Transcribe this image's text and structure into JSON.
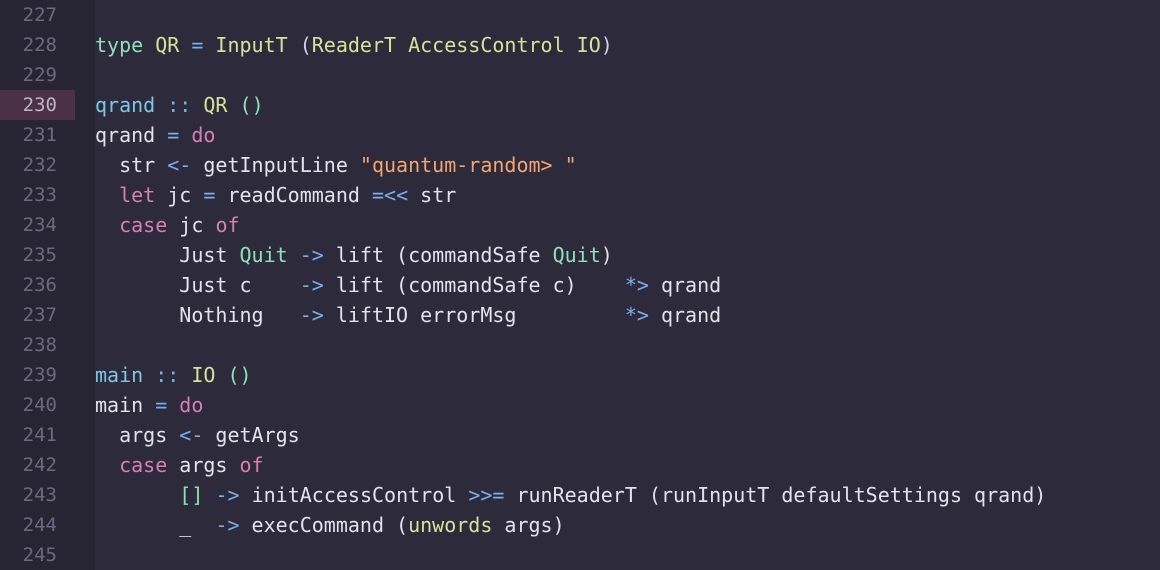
{
  "editor": {
    "current_line": 230,
    "lines": [
      {
        "n": "227",
        "tokens": []
      },
      {
        "n": "228",
        "tokens": [
          {
            "t": "type",
            "c": "tok-con"
          },
          {
            "t": " QR ",
            "c": "tok-type"
          },
          {
            "t": "=",
            "c": "tok-op"
          },
          {
            "t": " InputT ",
            "c": "tok-type"
          },
          {
            "t": "(",
            "c": "tok-paren"
          },
          {
            "t": "ReaderT AccessControl IO",
            "c": "tok-type"
          },
          {
            "t": ")",
            "c": "tok-paren"
          }
        ]
      },
      {
        "n": "229",
        "tokens": []
      },
      {
        "n": "230",
        "tokens": [
          {
            "t": "qrand",
            "c": "tok-fn"
          },
          {
            "t": " :: ",
            "c": "tok-op"
          },
          {
            "t": "QR",
            "c": "tok-type"
          },
          {
            "t": " ()",
            "c": "tok-con"
          }
        ]
      },
      {
        "n": "231",
        "tokens": [
          {
            "t": "qrand ",
            "c": "tok-plain"
          },
          {
            "t": "=",
            "c": "tok-op"
          },
          {
            "t": " do",
            "c": "tok-kw"
          }
        ]
      },
      {
        "n": "232",
        "tokens": [
          {
            "t": "  str ",
            "c": "tok-plain"
          },
          {
            "t": "<-",
            "c": "tok-op"
          },
          {
            "t": " getInputLine ",
            "c": "tok-plain"
          },
          {
            "t": "\"quantum-random> \"",
            "c": "tok-str"
          }
        ]
      },
      {
        "n": "233",
        "tokens": [
          {
            "t": "  ",
            "c": "tok-plain"
          },
          {
            "t": "let",
            "c": "tok-kw"
          },
          {
            "t": " jc ",
            "c": "tok-plain"
          },
          {
            "t": "=",
            "c": "tok-op"
          },
          {
            "t": " readCommand ",
            "c": "tok-plain"
          },
          {
            "t": "=<<",
            "c": "tok-op"
          },
          {
            "t": " str",
            "c": "tok-plain"
          }
        ]
      },
      {
        "n": "234",
        "tokens": [
          {
            "t": "  ",
            "c": "tok-plain"
          },
          {
            "t": "case",
            "c": "tok-kw"
          },
          {
            "t": " jc ",
            "c": "tok-plain"
          },
          {
            "t": "of",
            "c": "tok-kw"
          }
        ]
      },
      {
        "n": "235",
        "tokens": [
          {
            "t": "       Just ",
            "c": "tok-plain"
          },
          {
            "t": "Quit",
            "c": "tok-con"
          },
          {
            "t": " ",
            "c": "tok-plain"
          },
          {
            "t": "->",
            "c": "tok-op"
          },
          {
            "t": " lift (commandSafe ",
            "c": "tok-plain"
          },
          {
            "t": "Quit",
            "c": "tok-con"
          },
          {
            "t": ")",
            "c": "tok-plain"
          }
        ]
      },
      {
        "n": "236",
        "tokens": [
          {
            "t": "       Just c    ",
            "c": "tok-plain"
          },
          {
            "t": "->",
            "c": "tok-op"
          },
          {
            "t": " lift (commandSafe c)    ",
            "c": "tok-plain"
          },
          {
            "t": "*>",
            "c": "tok-op"
          },
          {
            "t": " qrand",
            "c": "tok-plain"
          }
        ]
      },
      {
        "n": "237",
        "tokens": [
          {
            "t": "       Nothing   ",
            "c": "tok-plain"
          },
          {
            "t": "->",
            "c": "tok-op"
          },
          {
            "t": " liftIO errorMsg         ",
            "c": "tok-plain"
          },
          {
            "t": "*>",
            "c": "tok-op"
          },
          {
            "t": " qrand",
            "c": "tok-plain"
          }
        ]
      },
      {
        "n": "238",
        "tokens": []
      },
      {
        "n": "239",
        "tokens": [
          {
            "t": "main",
            "c": "tok-fn"
          },
          {
            "t": " :: ",
            "c": "tok-op"
          },
          {
            "t": "IO",
            "c": "tok-type"
          },
          {
            "t": " ()",
            "c": "tok-con"
          }
        ]
      },
      {
        "n": "240",
        "tokens": [
          {
            "t": "main ",
            "c": "tok-plain"
          },
          {
            "t": "=",
            "c": "tok-op"
          },
          {
            "t": " do",
            "c": "tok-kw"
          }
        ]
      },
      {
        "n": "241",
        "tokens": [
          {
            "t": "  args ",
            "c": "tok-plain"
          },
          {
            "t": "<-",
            "c": "tok-op"
          },
          {
            "t": " getArgs",
            "c": "tok-plain"
          }
        ]
      },
      {
        "n": "242",
        "tokens": [
          {
            "t": "  ",
            "c": "tok-plain"
          },
          {
            "t": "case",
            "c": "tok-kw"
          },
          {
            "t": " args ",
            "c": "tok-plain"
          },
          {
            "t": "of",
            "c": "tok-kw"
          }
        ]
      },
      {
        "n": "243",
        "tokens": [
          {
            "t": "       ",
            "c": "tok-plain"
          },
          {
            "t": "[]",
            "c": "tok-con"
          },
          {
            "t": " ",
            "c": "tok-plain"
          },
          {
            "t": "->",
            "c": "tok-op"
          },
          {
            "t": " initAccessControl ",
            "c": "tok-plain"
          },
          {
            "t": ">>=",
            "c": "tok-op"
          },
          {
            "t": " runReaderT (runInputT defaultSettings qrand)",
            "c": "tok-plain"
          }
        ]
      },
      {
        "n": "244",
        "tokens": [
          {
            "t": "       _  ",
            "c": "tok-plain"
          },
          {
            "t": "->",
            "c": "tok-op"
          },
          {
            "t": " execCommand (",
            "c": "tok-plain"
          },
          {
            "t": "unwords",
            "c": "tok-type"
          },
          {
            "t": " args)",
            "c": "tok-plain"
          }
        ]
      },
      {
        "n": "245",
        "tokens": []
      }
    ]
  }
}
